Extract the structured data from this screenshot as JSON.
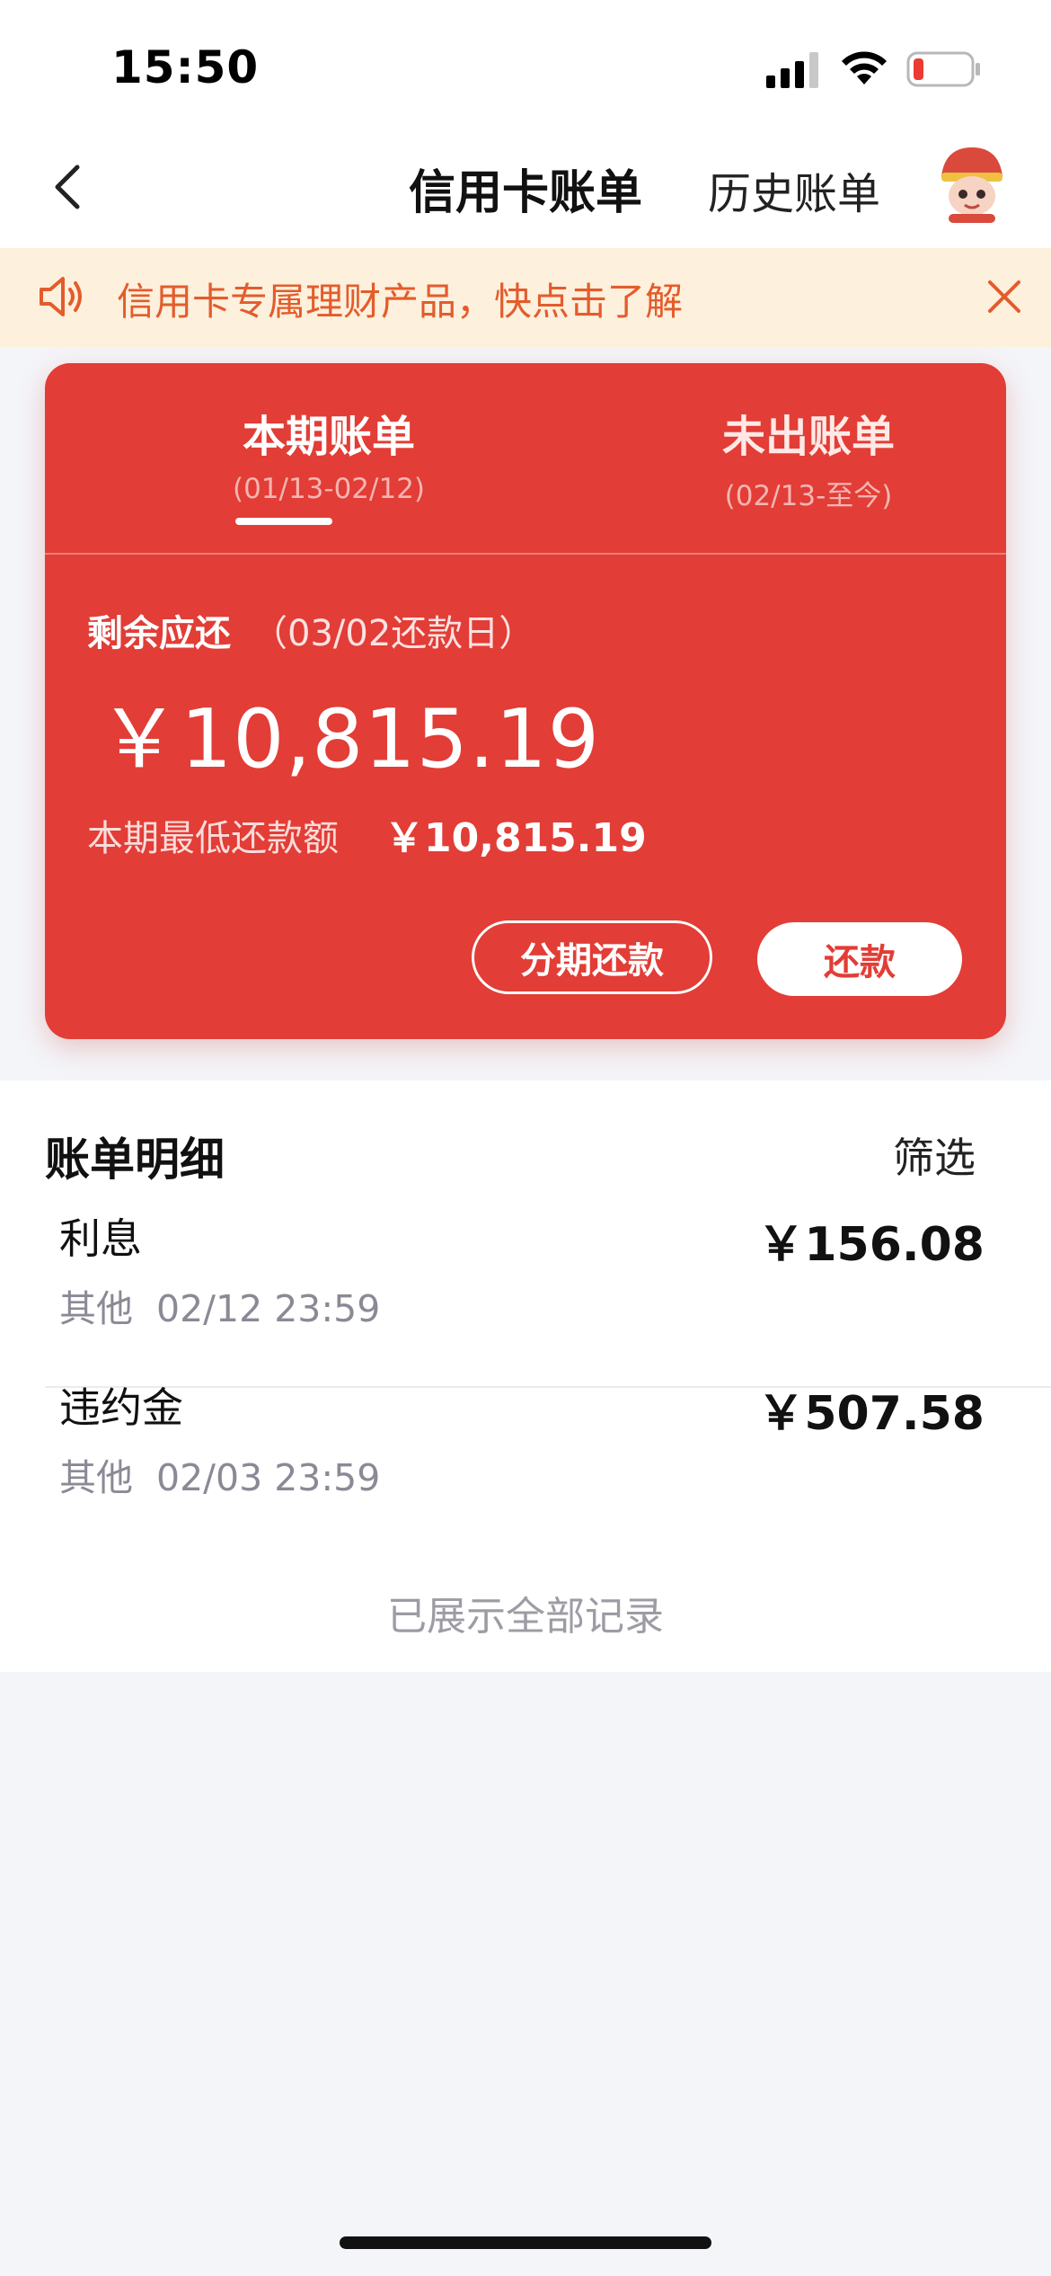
{
  "status_bar": {
    "time": "15:50"
  },
  "nav": {
    "title": "信用卡账单",
    "history": "历史账单"
  },
  "notice": {
    "text": "信用卡专属理财产品，快点击了解"
  },
  "card": {
    "tabs": [
      {
        "label": "本期账单",
        "range": "(01/13-02/12)"
      },
      {
        "label": "未出账单",
        "range": "(02/13-至今)"
      }
    ],
    "remaining_label": "剩余应还",
    "due_date": "（03/02还款日）",
    "remaining_amount": "￥10,815.19",
    "min_label": "本期最低还款额",
    "min_amount": "￥10,815.19",
    "installment_button": "分期还款",
    "repay_button": "还款"
  },
  "details": {
    "title": "账单明细",
    "filter": "筛选",
    "items": [
      {
        "name": "利息",
        "category": "其他",
        "time": "02/12 23:59",
        "amount": "￥156.08"
      },
      {
        "name": "违约金",
        "category": "其他",
        "time": "02/03 23:59",
        "amount": "￥507.58"
      }
    ],
    "footer": "已展示全部记录"
  },
  "colors": {
    "brand_red": "#e23d36",
    "notice_bg": "#fdf0dc",
    "notice_text": "#e35c2c"
  },
  "icons": [
    "back-icon",
    "speaker-icon",
    "close-icon",
    "signal-icon",
    "wifi-icon",
    "battery-icon",
    "avatar"
  ]
}
